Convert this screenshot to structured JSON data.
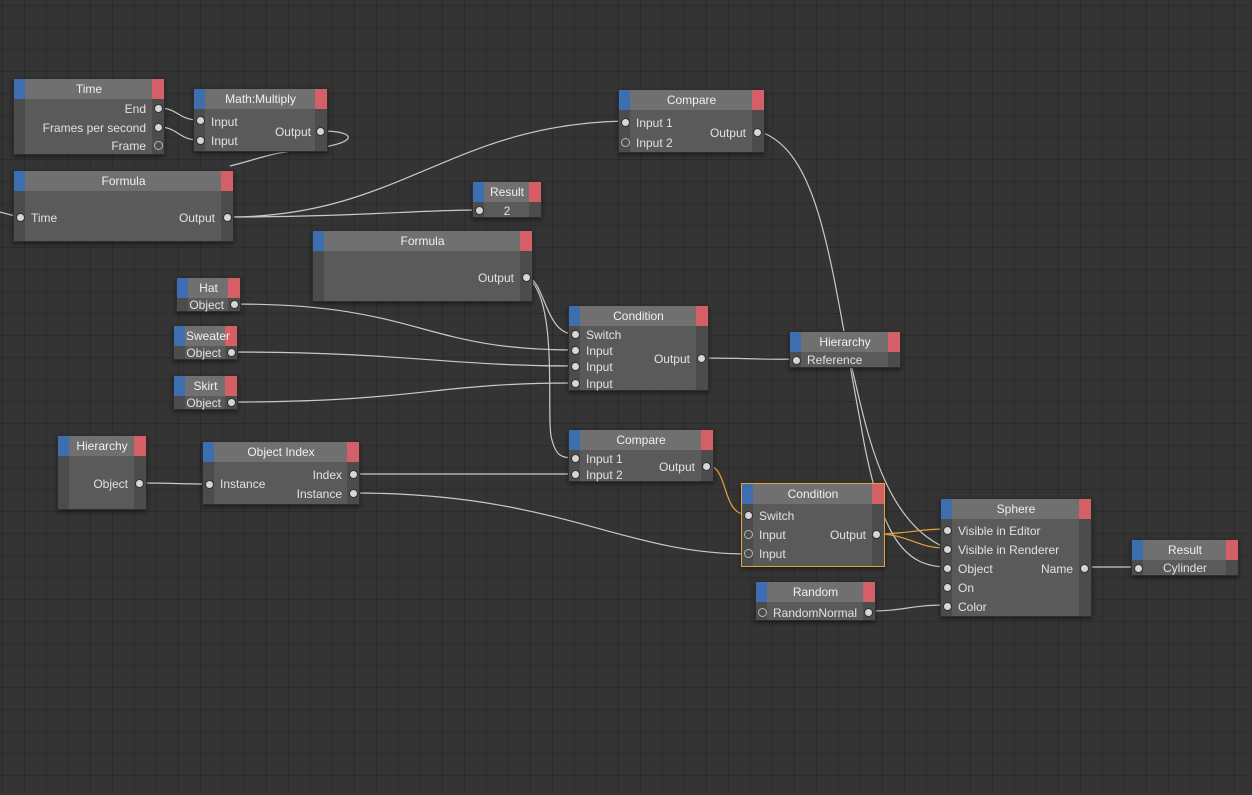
{
  "colors": {
    "background": "#343434",
    "node_body": "#5a5a5a",
    "node_header": "#707070",
    "input_accent": "#3d6fb0",
    "output_accent": "#d45f66",
    "wire": "#c9c9c9",
    "wire_active": "#e6a23c",
    "selected_outline": "#e6a23c"
  },
  "nodes": {
    "time": {
      "title": "Time",
      "ports": {
        "end": "End",
        "fps": "Frames per second",
        "frame": "Frame"
      }
    },
    "multiply": {
      "title": "Math:Multiply",
      "ports": {
        "input_a": "Input",
        "input_b": "Input",
        "output": "Output"
      }
    },
    "compare_top": {
      "title": "Compare",
      "ports": {
        "input1": "Input 1",
        "input2": "Input 2",
        "output": "Output"
      }
    },
    "formula_time": {
      "title": "Formula",
      "ports": {
        "time": "Time",
        "output": "Output"
      }
    },
    "result_top": {
      "title": "Result",
      "value": "2"
    },
    "formula_mid": {
      "title": "Formula",
      "ports": {
        "output": "Output"
      }
    },
    "hat": {
      "title": "Hat",
      "ports": {
        "object": "Object"
      }
    },
    "sweater": {
      "title": "Sweater",
      "ports": {
        "object": "Object"
      }
    },
    "skirt": {
      "title": "Skirt",
      "ports": {
        "object": "Object"
      }
    },
    "condition_top": {
      "title": "Condition",
      "ports": {
        "switch": "Switch",
        "input1": "Input",
        "input2": "Input",
        "input3": "Input",
        "output": "Output"
      }
    },
    "hierarchy_right": {
      "title": "Hierarchy",
      "ports": {
        "reference": "Reference"
      }
    },
    "hierarchy_left": {
      "title": "Hierarchy",
      "ports": {
        "object": "Object"
      }
    },
    "object_index": {
      "title": "Object Index",
      "ports": {
        "instance_in": "Instance",
        "index": "Index",
        "instance_out": "Instance"
      }
    },
    "compare_mid": {
      "title": "Compare",
      "ports": {
        "input1": "Input 1",
        "input2": "Input 2",
        "output": "Output"
      }
    },
    "condition_sel": {
      "title": "Condition",
      "ports": {
        "switch": "Switch",
        "input1": "Input",
        "input2": "Input",
        "output": "Output"
      }
    },
    "sphere": {
      "title": "Sphere",
      "ports": {
        "visible_editor": "Visible in Editor",
        "visible_renderer": "Visible in Renderer",
        "object": "Object",
        "on": "On",
        "color": "Color",
        "name": "Name"
      }
    },
    "random": {
      "title": "Random",
      "ports": {
        "random": "Random",
        "normal": "Normal"
      }
    },
    "result_right": {
      "title": "Result",
      "value": "Cylinder"
    }
  }
}
